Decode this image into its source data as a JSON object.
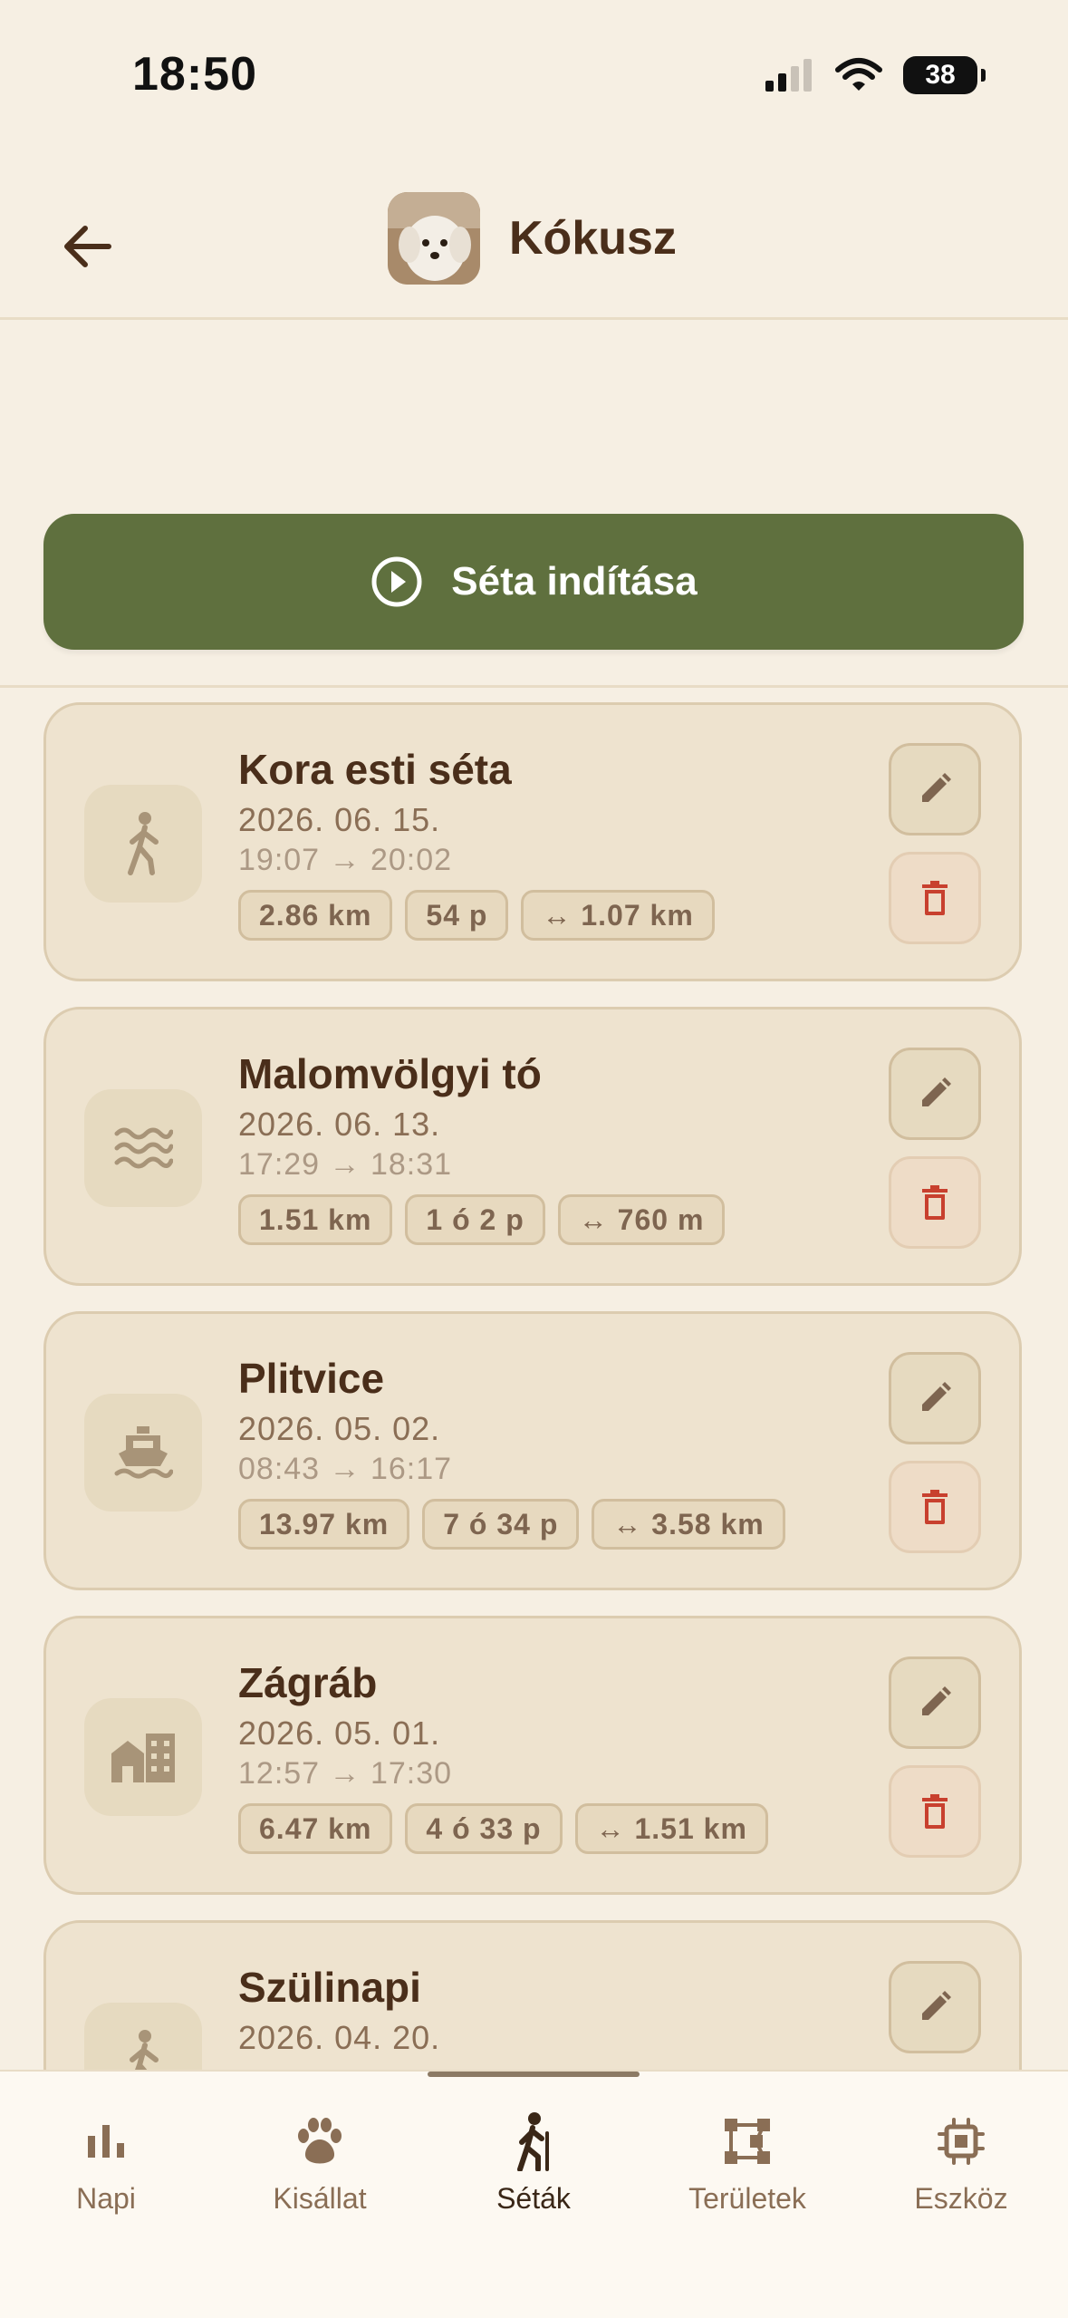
{
  "status_bar": {
    "time": "18:50",
    "battery": "38"
  },
  "header": {
    "pet_name": "Kókusz"
  },
  "actions": {
    "start_walk_label": "Séta indítása"
  },
  "walks": [
    {
      "title": "Kora esti séta",
      "date": "2026. 06. 15.",
      "time": "19:07 → 20:02",
      "distance": "2.86 km",
      "duration": "54 p",
      "span": "↔ 1.07 km",
      "icon": "walking-person-icon"
    },
    {
      "title": "Malomvölgyi tó",
      "date": "2026. 06. 13.",
      "time": "17:29 → 18:31",
      "distance": "1.51 km",
      "duration": "1 ó 2 p",
      "span": "↔ 760 m",
      "icon": "waves-icon"
    },
    {
      "title": "Plitvice",
      "date": "2026. 05. 02.",
      "time": "08:43 → 16:17",
      "distance": "13.97 km",
      "duration": "7 ó 34 p",
      "span": "↔ 3.58 km",
      "icon": "boat-icon"
    },
    {
      "title": "Zágráb",
      "date": "2026. 05. 01.",
      "time": "12:57 → 17:30",
      "distance": "6.47 km",
      "duration": "4 ó 33 p",
      "span": "↔ 1.51 km",
      "icon": "city-icon"
    },
    {
      "title": "Szülinapi",
      "date": "2026. 04. 20.",
      "time": "",
      "distance": "",
      "duration": "",
      "span": "",
      "icon": "walking-person-icon"
    }
  ],
  "nav": {
    "items": [
      {
        "label": "Napi",
        "icon": "bar-chart-icon"
      },
      {
        "label": "Kisállat",
        "icon": "paw-icon"
      },
      {
        "label": "Séták",
        "icon": "hiking-icon"
      },
      {
        "label": "Területek",
        "icon": "polygon-icon"
      },
      {
        "label": "Eszköz",
        "icon": "chip-icon"
      }
    ],
    "active": "Séták"
  },
  "colors": {
    "accent_green": "#5F703E",
    "text_brown": "#4A2E1A",
    "delete_red": "#C8402E",
    "background": "#F6EFE3"
  }
}
